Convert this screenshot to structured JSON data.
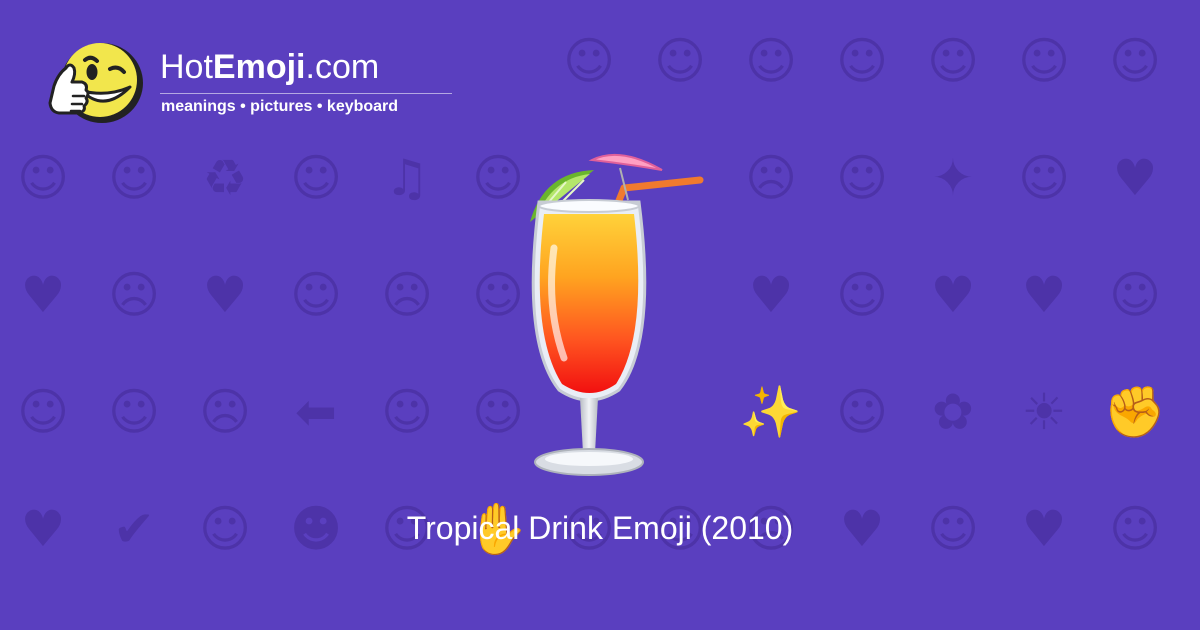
{
  "colors": {
    "background": "#5a3fbf",
    "pattern_glyph": "#4d33a8",
    "mascot_yellow": "#f2e64c",
    "text": "#ffffff"
  },
  "logo": {
    "name_prefix": "Hot",
    "name_bold": "Emoji",
    "name_suffix": ".com",
    "tagline": "meanings • pictures • keyboard",
    "mascot_icon": "winking-thumbs-up-face-icon"
  },
  "hero": {
    "icon": "tropical-drink-icon"
  },
  "caption": "Tropical Drink Emoji (2010)",
  "background_pattern": {
    "icon_names": [
      "smiley-face-icon",
      "heart-icon",
      "star-icon",
      "sparkle-icon",
      "hand-icon",
      "music-note-icon",
      "arrow-icon",
      "sun-icon",
      "flower-icon",
      "check-icon"
    ],
    "glyphs": [
      [
        "☺",
        "☺",
        "☺",
        "☹",
        "☺",
        "♥",
        "☺",
        "☺",
        "☺",
        "☺",
        "☺",
        "☺",
        "☺"
      ],
      [
        "☺",
        "☺",
        "♻",
        "☺",
        "♫",
        "☺",
        "☺",
        "☺",
        "☹",
        "☺",
        "✦",
        "☺",
        "♥"
      ],
      [
        "♥",
        "☹",
        "♥",
        "☺",
        "☹",
        "☺",
        "☺",
        "✋",
        "♥",
        "☺",
        "♥",
        "♥",
        "☺"
      ],
      [
        "☺",
        "☺",
        "☹",
        "⬅",
        "☺",
        "☺",
        "☺",
        "✊",
        "✨",
        "☺",
        "✿",
        "☀",
        "✊"
      ],
      [
        "♥",
        "✔",
        "☺",
        "☻",
        "☺",
        "✋",
        "☺",
        "☺",
        "☹",
        "♥",
        "☺",
        "♥",
        "☺"
      ]
    ]
  }
}
